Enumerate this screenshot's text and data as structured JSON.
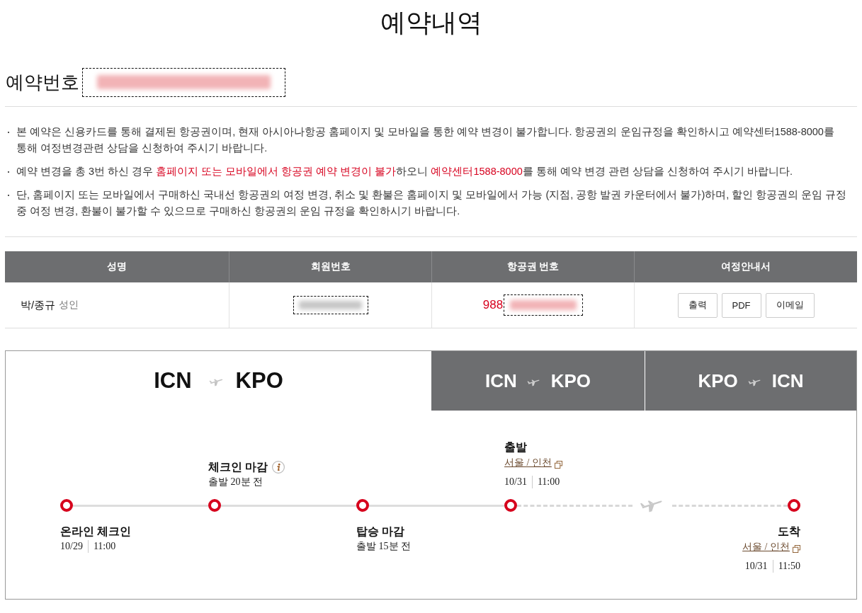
{
  "page_title": "예약내역",
  "reservation": {
    "label": "예약번호",
    "number_hidden": true
  },
  "notices": [
    {
      "segments": [
        {
          "text": "본 예약은 신용카드를 통해 결제된 항공권이며, 현재 아시아나항공 홈페이지 및 모바일을 통한 예약 변경이 불가합니다. 항공권의 운임규정을 확인하시고 예약센터1588-8000를 통해 여정변경관련 상담을 신청하여 주시기 바랍니다.",
          "highlight": false
        }
      ]
    },
    {
      "segments": [
        {
          "text": "예약 변경을 총 3번 하신 경우 ",
          "highlight": false
        },
        {
          "text": "홈페이지 또는 모바일에서 항공권 예약 변경이 불가",
          "highlight": true
        },
        {
          "text": "하오니 ",
          "highlight": false
        },
        {
          "text": "예약센터1588-8000",
          "highlight": true
        },
        {
          "text": "를 통해 예약 변경 관련 상담을 신청하여 주시기 바랍니다.",
          "highlight": false
        }
      ]
    },
    {
      "segments": [
        {
          "text": "단, 홈페이지 또는 모바일에서 구매하신 국내선 항공권의 여정 변경, 취소 및 환불은 홈페이지 및 모바일에서 가능 (지점, 공항 발권 카운터에서 불가)하며, 할인 항공권의 운임 규정 중 여정 변경, 환불이 불가할 수 있으므로 구매하신 항공권의 운임 규정을 확인하시기 바랍니다.",
          "highlight": false
        }
      ]
    }
  ],
  "passenger_table": {
    "columns": [
      "성명",
      "회원번호",
      "항공권 번호",
      "여정안내서"
    ],
    "rows": [
      {
        "name": "박/종규",
        "type": "성인",
        "member_number_hidden": true,
        "ticket_prefix": "988",
        "ticket_rest_hidden": true,
        "buttons": [
          "출력",
          "PDF",
          "이메일"
        ]
      }
    ]
  },
  "tabs": [
    {
      "from": "ICN",
      "to": "KPO",
      "selected": true
    },
    {
      "from": "ICN",
      "to": "KPO",
      "selected": false
    },
    {
      "from": "KPO",
      "to": "ICN",
      "selected": false
    }
  ],
  "timeline": {
    "steps": [
      {
        "title": "온라인 체크인",
        "info": false,
        "date": "10/29",
        "time": "11:00"
      },
      {
        "title": "체크인 마감",
        "info": true,
        "note": "출발 20분 전"
      },
      {
        "title": "탑승 마감",
        "info": false,
        "note": "출발 15분 전"
      },
      {
        "title": "출발",
        "info": false,
        "place": "서울 / 인천",
        "date": "10/31",
        "time": "11:00"
      },
      {
        "title": "도착",
        "info": false,
        "place": "서울 / 인천",
        "date": "10/31",
        "time": "11:50"
      }
    ],
    "segments": [
      {
        "kind": "ground"
      },
      {
        "kind": "ground"
      },
      {
        "kind": "ground"
      },
      {
        "kind": "flight"
      }
    ]
  }
}
